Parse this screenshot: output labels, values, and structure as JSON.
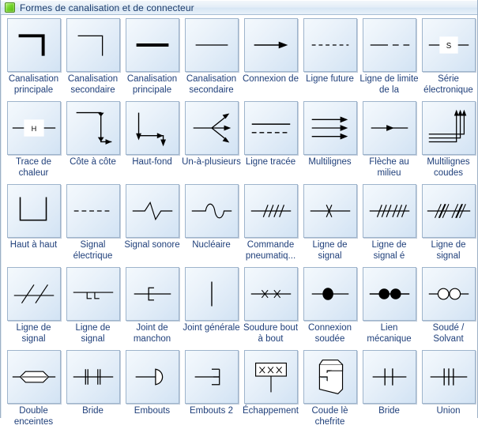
{
  "window": {
    "title": "Formes de canalisation et de connecteur",
    "icon": "green-square-icon"
  },
  "colors": {
    "title_text": "#1b3b6b",
    "label_text": "#1f3f7a",
    "tile_border": "#9eb4cc",
    "icon_stroke": "#000000",
    "accent_green": "#74d62c"
  },
  "stencil": {
    "columns": 8,
    "items": [
      {
        "label": "Canalisation principale",
        "icon": "elbow-thick-icon"
      },
      {
        "label": "Canalisation secondaire",
        "icon": "elbow-thin-icon"
      },
      {
        "label": "Canalisation principale",
        "icon": "line-thick-icon"
      },
      {
        "label": "Canalisation secondaire",
        "icon": "line-thin-icon"
      },
      {
        "label": "Connexion de",
        "icon": "arrow-right-icon"
      },
      {
        "label": "Ligne future",
        "icon": "dashed-line-icon"
      },
      {
        "label": "Ligne de limite de la",
        "icon": "dash-dot-line-icon"
      },
      {
        "label": "Série électronique",
        "icon": "series-s-box-icon"
      },
      {
        "label": "Trace de chaleur",
        "icon": "heat-trace-h-box-icon"
      },
      {
        "label": "Côte à côte",
        "icon": "side-by-side-zigzag-icon"
      },
      {
        "label": "Haut-fond",
        "icon": "top-bottom-step-icon"
      },
      {
        "label": "Un-à-plusieurs",
        "icon": "one-to-many-fan-icon"
      },
      {
        "label": "Ligne tracée",
        "icon": "traced-line-icon"
      },
      {
        "label": "Multilignes",
        "icon": "multiline-arrows-icon"
      },
      {
        "label": "Flèche au milieu",
        "icon": "arrow-mid-icon"
      },
      {
        "label": "Multilignes coudes",
        "icon": "multiline-elbow-icon"
      },
      {
        "label": "Haut à haut",
        "icon": "top-to-top-u-icon"
      },
      {
        "label": "Signal électrique",
        "icon": "electric-dashed-icon"
      },
      {
        "label": "Signal sonore",
        "icon": "sound-zigzag-icon"
      },
      {
        "label": "Nucléaire",
        "icon": "nuclear-sine-icon"
      },
      {
        "label": "Commande pneumatiq...",
        "icon": "pneumatic-ticks-icon"
      },
      {
        "label": "Ligne de signal",
        "icon": "signal-double-tick-icon"
      },
      {
        "label": "Ligne de signal é",
        "icon": "signal-triple-tick-pair-icon"
      },
      {
        "label": "Ligne de signal",
        "icon": "signal-hatch-pair-icon"
      },
      {
        "label": "Ligne de signal",
        "icon": "signal-two-slashes-icon"
      },
      {
        "label": "Ligne de signal",
        "icon": "signal-step-pair-icon"
      },
      {
        "label": "Joint de manchon",
        "icon": "sleeve-joint-icon"
      },
      {
        "label": "Joint générale",
        "icon": "general-joint-bar-icon"
      },
      {
        "label": "Soudure bout à bout",
        "icon": "butt-weld-x-icon"
      },
      {
        "label": "Connexion soudée",
        "icon": "welded-dot-icon"
      },
      {
        "label": "Lien mécanique",
        "icon": "mechanical-two-dots-icon"
      },
      {
        "label": "Soudé / Solvant",
        "icon": "solvent-two-circles-icon"
      },
      {
        "label": "Double enceintes",
        "icon": "double-containment-icon"
      },
      {
        "label": "Bride",
        "icon": "flange-double-tick-icon"
      },
      {
        "label": "Embouts",
        "icon": "cap-d-icon"
      },
      {
        "label": "Embouts 2",
        "icon": "cap-bracket-icon"
      },
      {
        "label": "Échappement",
        "icon": "exhaust-xxx-box-icon"
      },
      {
        "label": "Coude lè chefrite",
        "icon": "bevel-elbow-3d-icon"
      },
      {
        "label": "Bride",
        "icon": "flange-pair-icon"
      },
      {
        "label": "Union",
        "icon": "union-icon"
      }
    ]
  }
}
